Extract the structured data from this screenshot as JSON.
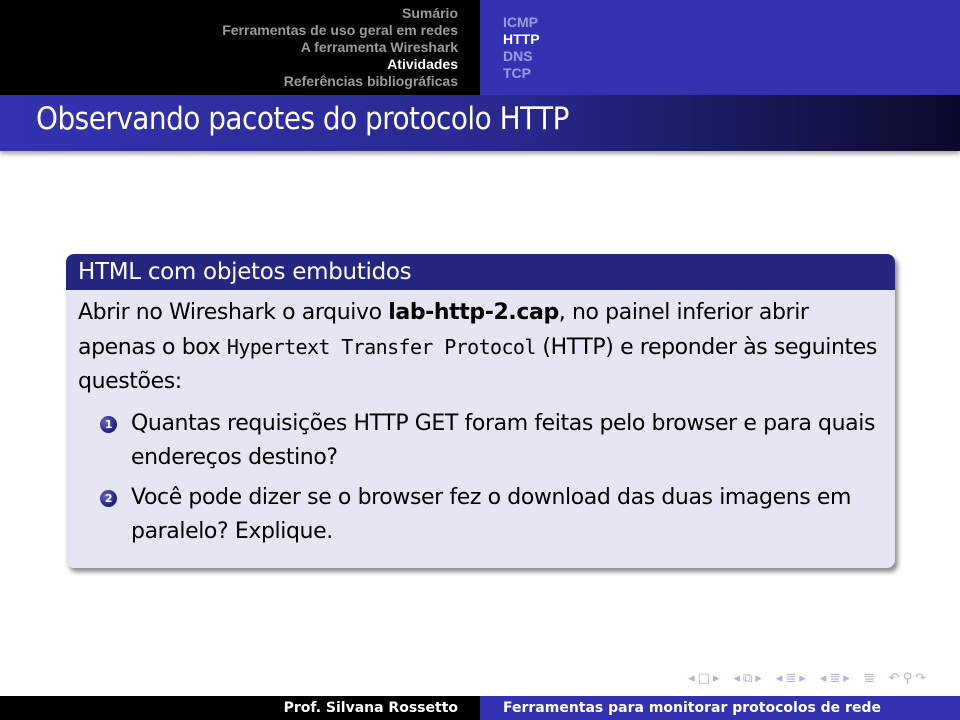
{
  "header": {
    "sections": [
      {
        "label": "Sumário",
        "active": false
      },
      {
        "label": "Ferramentas de uso geral em redes",
        "active": false
      },
      {
        "label": "A ferramenta Wireshark",
        "active": false
      },
      {
        "label": "Atividades",
        "active": true
      },
      {
        "label": "Referências bibliográficas",
        "active": false
      }
    ],
    "subsections": [
      {
        "label": "ICMP",
        "active": false
      },
      {
        "label": "HTTP",
        "active": true
      },
      {
        "label": "DNS",
        "active": false
      },
      {
        "label": "TCP",
        "active": false
      }
    ]
  },
  "frame": {
    "title": "Observando pacotes do protocolo HTTP"
  },
  "block": {
    "title": "HTML com objetos embutidos",
    "intro": {
      "part1": "Abrir no Wireshark o arquivo ",
      "filename": "lab-http-2.cap",
      "part2": ", no painel inferior abrir apenas o box ",
      "code": "Hypertext Transfer Protocol",
      "part3": " (HTTP) e reponder às seguintes questões:"
    },
    "items": [
      {
        "number": "1",
        "text": "Quantas requisições HTTP GET foram feitas pelo browser e para quais endereços destino?"
      },
      {
        "number": "2",
        "text": "Você pode dizer se o browser fez o download das duas imagens em paralelo? Explique."
      }
    ]
  },
  "navigation_symbols": {
    "frame": "frame-nav-icon",
    "subsection": "subsection-nav-icon",
    "section": "section-nav-icon",
    "doc": "document-nav-icon",
    "search": "search-icon",
    "undo": "back-icon",
    "redo": "forward-icon"
  },
  "footer": {
    "author": "Prof. Silvana Rossetto",
    "title": "Ferramentas para monitorar protocolos de rede"
  }
}
